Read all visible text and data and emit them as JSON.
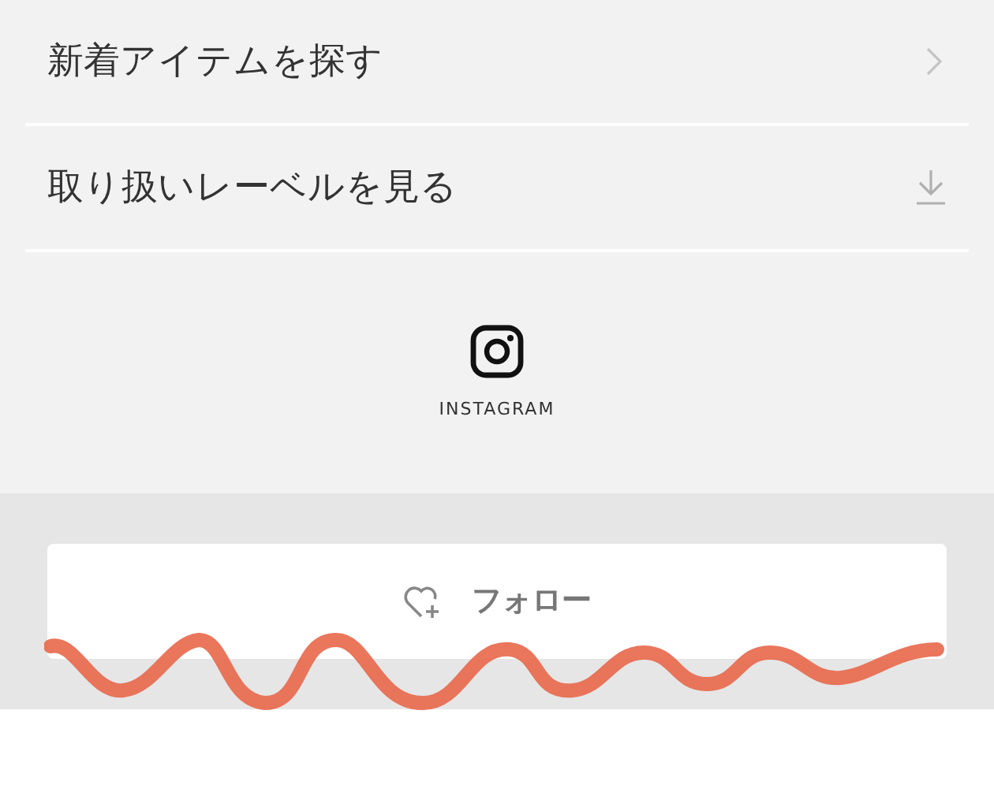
{
  "menu": [
    {
      "label": "新着アイテムを探す",
      "kind": "link"
    },
    {
      "label": "取り扱いレーベルを見る",
      "kind": "download"
    }
  ],
  "social": {
    "label": "INSTAGRAM"
  },
  "follow_button": {
    "label": "フォロー"
  }
}
